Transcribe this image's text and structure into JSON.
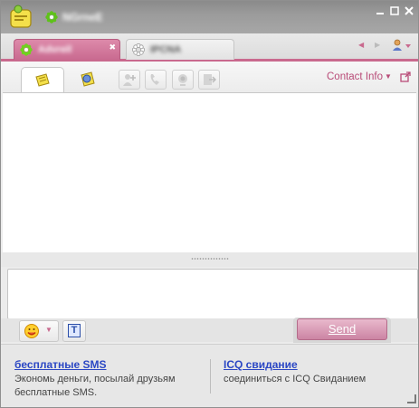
{
  "window": {
    "contact_name": "NGrneE",
    "controls": {
      "minimize_icon": "minimize-icon",
      "maximize_icon": "maximize-icon",
      "close_icon": "close-icon"
    }
  },
  "tabs": [
    {
      "label": "Advrell",
      "status_icon": "online-flower-icon",
      "active": true,
      "close": "✖"
    },
    {
      "label": "IPCNA",
      "status_icon": "offline-flower-icon",
      "active": false
    }
  ],
  "toolbar": {
    "contact_info_label": "Contact Info",
    "contact_info_arrow": "▼",
    "tools": [
      "chat-icon",
      "contact-card-icon",
      "add-user-icon",
      "call-icon",
      "webcam-icon",
      "send-file-icon"
    ]
  },
  "input": {
    "text": ""
  },
  "actions": {
    "smiley_arrow": "▼",
    "format_label": "T",
    "send_label": "Send"
  },
  "ads": [
    {
      "title": "бесплатные SMS",
      "text": "Экономь деньги, посылай друзьям бесплатные SMS."
    },
    {
      "title": "ICQ свидание",
      "text": "соединиться с ICQ Свиданием"
    }
  ],
  "colors": {
    "accent": "#c9698e",
    "link": "#2b47c4",
    "titlebar": "#9b9b9b"
  }
}
